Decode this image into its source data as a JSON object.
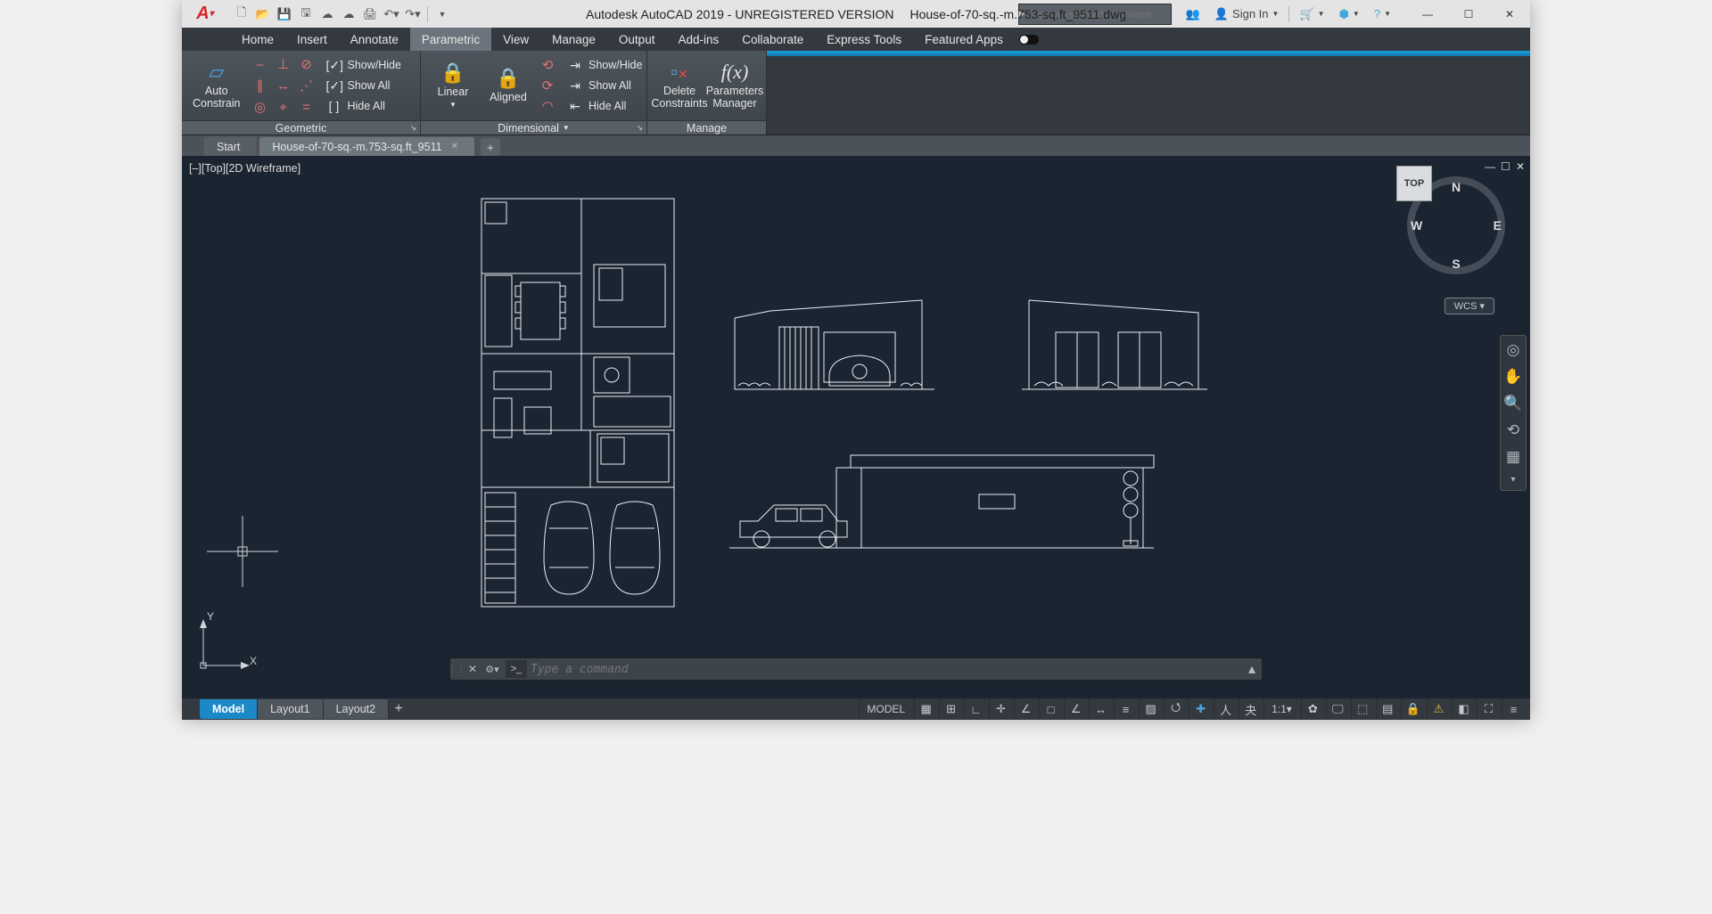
{
  "title": {
    "app": "Autodesk AutoCAD 2019 - UNREGISTERED VERSION",
    "file": "House-of-70-sq.-m.753-sq.ft_9511.dwg"
  },
  "search": {
    "placeholder": "Type a keyword or phrase"
  },
  "sign_in": "Sign In",
  "ribbon_tabs": [
    "Home",
    "Insert",
    "Annotate",
    "Parametric",
    "View",
    "Manage",
    "Output",
    "Add-ins",
    "Collaborate",
    "Express Tools",
    "Featured Apps"
  ],
  "active_ribbon_tab": "Parametric",
  "panels": {
    "geometric": {
      "title": "Geometric",
      "auto": "Auto\nConstrain",
      "show_hide": "Show/Hide",
      "show_all": "Show All",
      "hide_all": "Hide All"
    },
    "dimensional": {
      "title": "Dimensional",
      "linear": "Linear",
      "aligned": "Aligned",
      "show_hide": "Show/Hide",
      "show_all": "Show All",
      "hide_all": "Hide All"
    },
    "manage": {
      "title": "Manage",
      "delete": "Delete\nConstraints",
      "params": "Parameters\nManager"
    }
  },
  "file_tabs": {
    "start": "Start",
    "doc": "House-of-70-sq.-m.753-sq.ft_9511"
  },
  "viewport_label": "[–][Top][2D Wireframe]",
  "viewcube": {
    "n": "N",
    "s": "S",
    "e": "E",
    "w": "W",
    "top": "TOP"
  },
  "wcs": "WCS",
  "ucs": {
    "x": "X",
    "y": "Y"
  },
  "cmd": {
    "placeholder": "Type a command"
  },
  "layouts": [
    "Model",
    "Layout1",
    "Layout2"
  ],
  "status": {
    "model": "MODEL",
    "scale": "1:1"
  }
}
